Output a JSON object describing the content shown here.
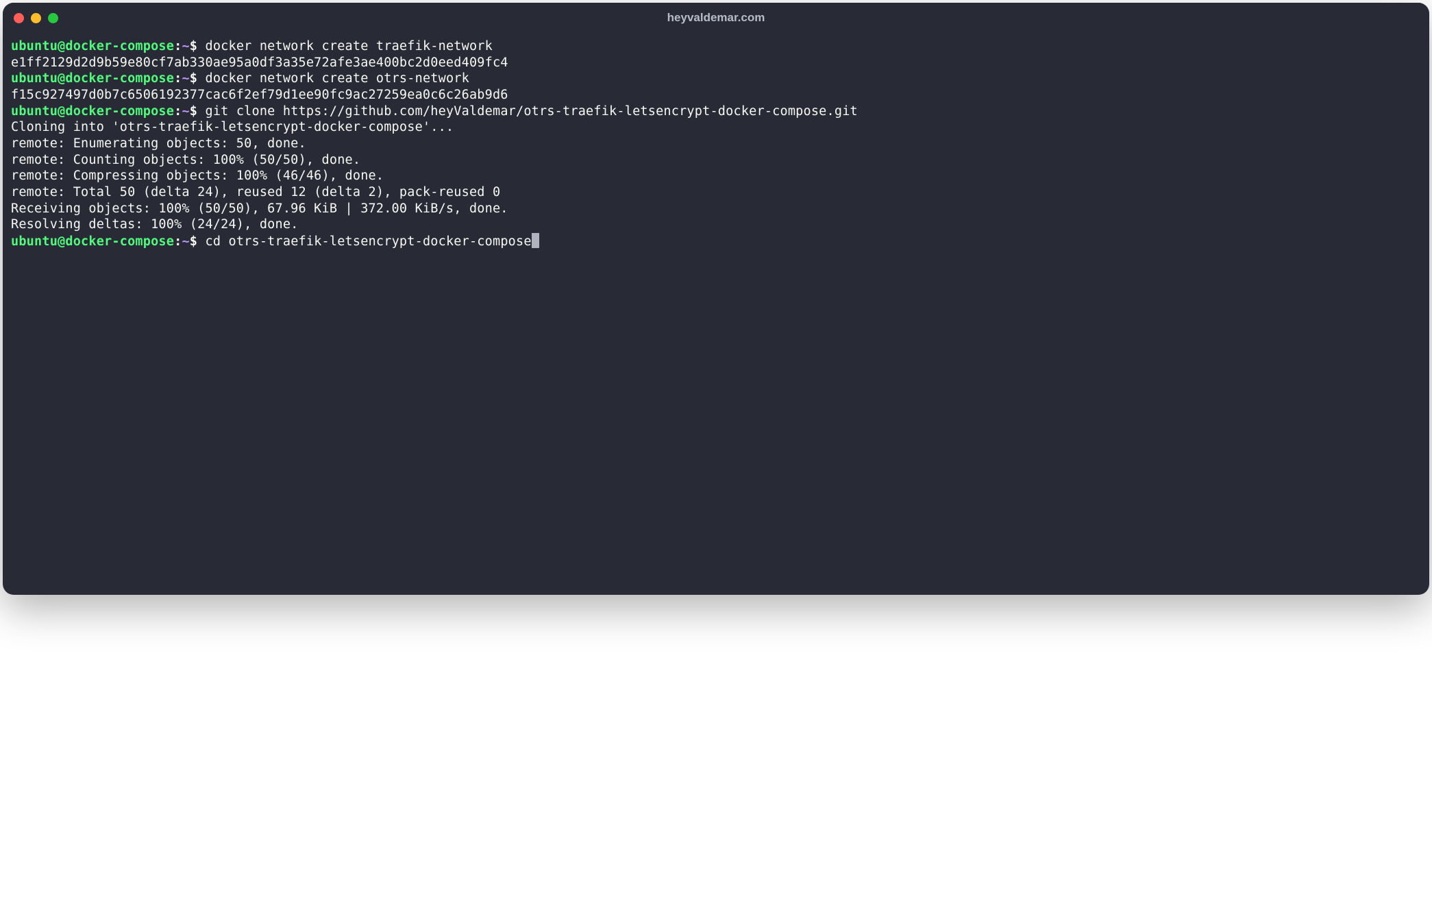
{
  "window": {
    "title": "heyvaldemar.com"
  },
  "colors": {
    "bg": "#282a36",
    "fg": "#f8f8f2",
    "green": "#50fa7b",
    "purple": "#bd93f9",
    "red_btn": "#ff5f56",
    "yellow_btn": "#ffbd2e",
    "green_btn": "#27c93f"
  },
  "prompt": {
    "user_host": "ubuntu@docker-compose",
    "colon": ":",
    "path": "~",
    "dollar": "$"
  },
  "lines": {
    "cmd1": " docker network create traefik-network",
    "out1": "e1ff2129d2d9b59e80cf7ab330ae95a0df3a35e72afe3ae400bc2d0eed409fc4",
    "cmd2": " docker network create otrs-network",
    "out2": "f15c927497d0b7c6506192377cac6f2ef79d1ee90fc9ac27259ea0c6c26ab9d6",
    "cmd3": " git clone https://github.com/heyValdemar/otrs-traefik-letsencrypt-docker-compose.git",
    "out3": "Cloning into 'otrs-traefik-letsencrypt-docker-compose'...",
    "out4": "remote: Enumerating objects: 50, done.",
    "out5": "remote: Counting objects: 100% (50/50), done.",
    "out6": "remote: Compressing objects: 100% (46/46), done.",
    "out7": "remote: Total 50 (delta 24), reused 12 (delta 2), pack-reused 0",
    "out8": "Receiving objects: 100% (50/50), 67.96 KiB | 372.00 KiB/s, done.",
    "out9": "Resolving deltas: 100% (24/24), done.",
    "cmd4": " cd otrs-traefik-letsencrypt-docker-compose"
  }
}
